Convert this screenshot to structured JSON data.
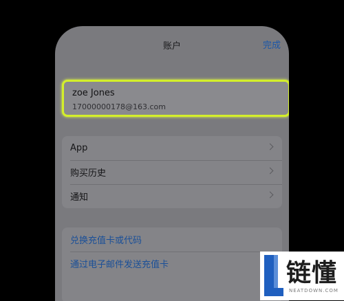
{
  "nav": {
    "title": "账户",
    "done_label": "完成"
  },
  "account": {
    "name": "zoe Jones",
    "email": "17000000178@163.com"
  },
  "menu": [
    {
      "label": "App"
    },
    {
      "label": "购买历史"
    },
    {
      "label": "通知"
    }
  ],
  "gift_links": [
    {
      "label": "兑换充值卡或代码"
    },
    {
      "label": "通过电子邮件发送充值卡"
    }
  ],
  "watermark": {
    "brand": "链懂",
    "site": "NEATDOWN.COM"
  },
  "colors": {
    "highlight": "#d4ef2a",
    "link": "#1a56a8"
  }
}
